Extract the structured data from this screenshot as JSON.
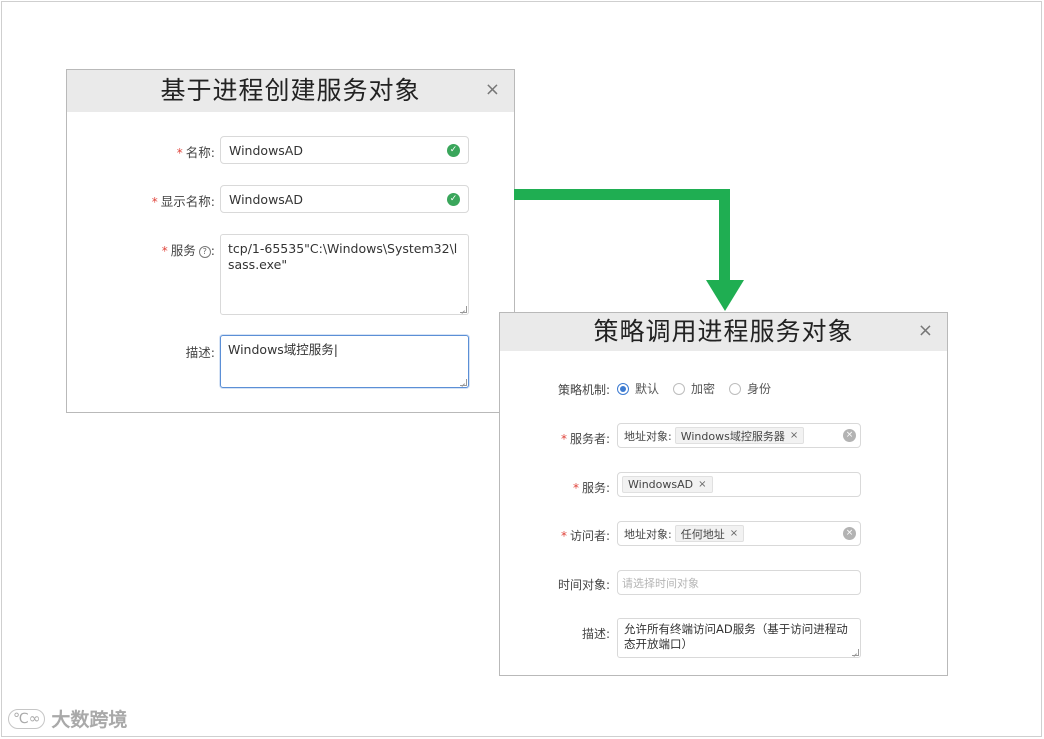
{
  "create_dialog": {
    "title": "基于进程创建服务对象",
    "close": "×",
    "name_label": "名称:",
    "name_value": "WindowsAD",
    "display_name_label": "显示名称:",
    "display_name_value": "WindowsAD",
    "service_label": "服务",
    "service_help": "?",
    "service_colon": ":",
    "service_value": "tcp/1-65535\"C:\\Windows\\System32\\lsass.exe\"",
    "desc_label": "描述:",
    "desc_value": "Windows域控服务|",
    "required_mark": "*",
    "check_glyph": "✓"
  },
  "policy_dialog": {
    "title": "策略调用进程服务对象",
    "close": "×",
    "mechanism_label": "策略机制:",
    "mechanism_options": [
      "默认",
      "加密",
      "身份"
    ],
    "mechanism_selected": "默认",
    "server_label": "服务者:",
    "server_prefix": "地址对象:",
    "server_tag": "Windows域控服务器",
    "service_label": "服务:",
    "service_tag": "WindowsAD",
    "visitor_label": "访问者:",
    "visitor_prefix": "地址对象:",
    "visitor_tag": "任何地址",
    "time_label": "时间对象:",
    "time_placeholder": "请选择时间对象",
    "desc_label": "描述:",
    "desc_value": "允许所有终端访问AD服务（基于访问进程动态开放端口）",
    "required_mark": "*",
    "tag_remove": "×",
    "clear_glyph": "×"
  },
  "watermark": {
    "logo": "℃∞",
    "text": "大数跨境"
  },
  "colors": {
    "arrow": "#1fae52",
    "required": "#e0443b",
    "success": "#3aa65b",
    "radio_active": "#3d7bd1"
  }
}
